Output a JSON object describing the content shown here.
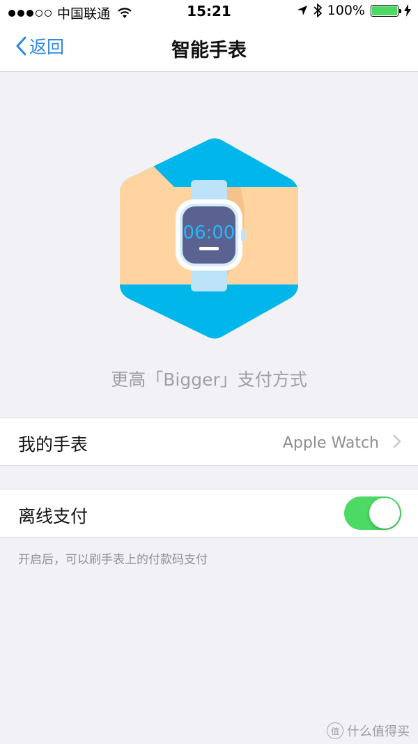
{
  "status_bar": {
    "carrier": "中国联通",
    "time": "15:21",
    "battery": "100%",
    "battery_level": 1.0,
    "icons": [
      "signal-dots-icon",
      "wifi-icon",
      "location-arrow-icon",
      "bluetooth-icon",
      "battery-icon",
      "charging-bolt-icon"
    ]
  },
  "nav": {
    "back_label": "返回",
    "title": "智能手表"
  },
  "hero": {
    "watch_time": "06:00",
    "caption": "更高「Bigger」支付方式",
    "colors": {
      "hexagon": "#00b6ea",
      "band": "#ffd4a0",
      "watch_face": "#5a6291",
      "digits": "#29b6f6",
      "strap": "#bde3f8"
    }
  },
  "rows": {
    "my_watch": {
      "label": "我的手表",
      "value": "Apple Watch"
    },
    "offline_pay": {
      "label": "离线支付",
      "enabled": true
    }
  },
  "footnote": "开启后，可以刷手表上的付款码支付",
  "watermark": {
    "badge": "值",
    "text": "什么值得买"
  },
  "colors": {
    "accent": "#2d89e6",
    "toggle_on": "#4cd964",
    "background": "#f2f2f6"
  }
}
